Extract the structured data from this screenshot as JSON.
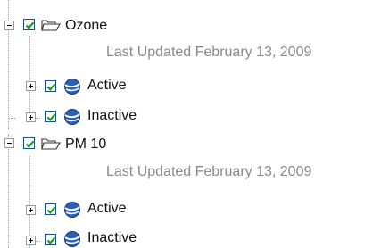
{
  "tree": {
    "groups": [
      {
        "label": "Ozone",
        "last_updated": "Last Updated February 13, 2009",
        "expanded": true,
        "checked": true,
        "children": [
          {
            "label": "Active",
            "checked": true,
            "expanded": false
          },
          {
            "label": "Inactive",
            "checked": true,
            "expanded": false
          }
        ]
      },
      {
        "label": "PM 10",
        "last_updated": "Last Updated February 13, 2009",
        "expanded": true,
        "checked": true,
        "children": [
          {
            "label": "Active",
            "checked": true,
            "expanded": false
          },
          {
            "label": "Inactive",
            "checked": true,
            "expanded": false
          }
        ]
      }
    ]
  },
  "colors": {
    "check_mark": "#1a9a1a",
    "checkbox_border": "#1c5180",
    "toggle_border": "#8f9cab",
    "sublabel_text": "#8a8a8a",
    "globe_blue": "#2b5fb8"
  },
  "icons": {
    "group_icon": "open-folder-icon",
    "child_icon": "globe-icon",
    "collapse": "minus-box-icon",
    "expand": "plus-box-icon"
  }
}
